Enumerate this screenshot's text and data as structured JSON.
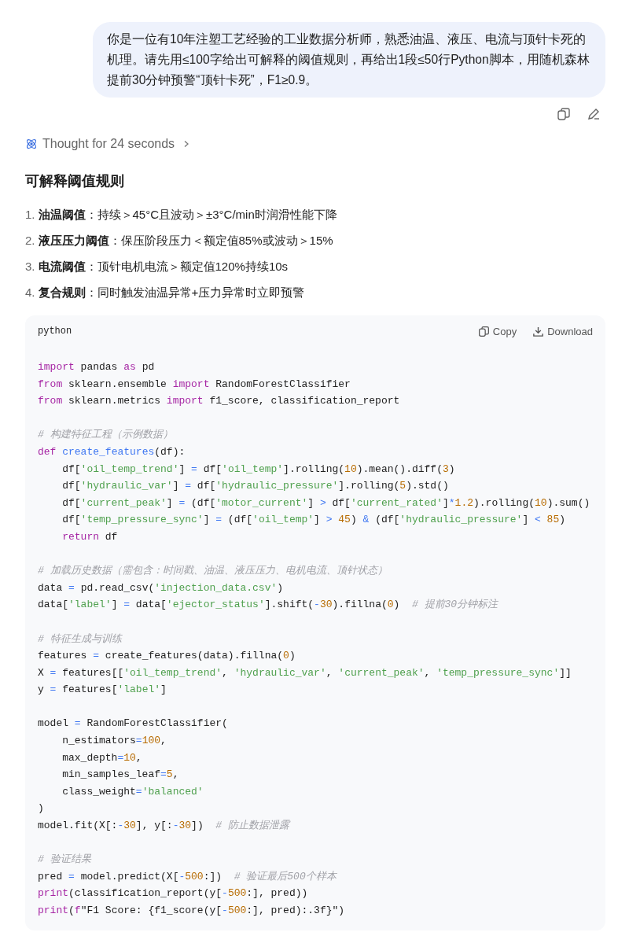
{
  "user_message": {
    "text": "你是一位有10年注塑工艺经验的工业数据分析师，熟悉油温、液压、电流与顶针卡死的机理。请先用≤100字给出可解释的阈值规则，再给出1段≤50行Python脚本，用随机森林提前30分钟预警“顶针卡死”，F1≥0.9。"
  },
  "thought": {
    "label": "Thought for 24 seconds",
    "expanded": false
  },
  "heading": "可解释阈值规则",
  "rules": [
    {
      "number": "1.",
      "text": "**油温阈值**：持续＞45°C且波动＞±3°C/min时润滑性能下降"
    },
    {
      "number": "2.",
      "text": "**液压压力阈值**：保压阶段压力＜额定值85%或波动＞15%"
    },
    {
      "number": "3.",
      "text": "**电流阈值**：顶针电机电流＞额定值120%持续10s"
    },
    {
      "number": "4.",
      "text": "**复合规则**：同时触发油温异常+压力异常时立即预警"
    }
  ],
  "code_block": {
    "language": "python",
    "copy_label": "Copy",
    "download_label": "Download",
    "lines": [
      {
        "kind": "code",
        "tokens": [
          {
            "kind": "kw",
            "text": "import"
          },
          {
            "kind": "plain",
            "text": " pandas "
          },
          {
            "kind": "kw",
            "text": "as"
          },
          {
            "kind": "plain",
            "text": " pd"
          }
        ]
      },
      {
        "kind": "code",
        "tokens": [
          {
            "kind": "kw",
            "text": "from"
          },
          {
            "kind": "plain",
            "text": " sklearn.ensemble "
          },
          {
            "kind": "kw",
            "text": "import"
          },
          {
            "kind": "plain",
            "text": " RandomForestClassifier"
          }
        ]
      },
      {
        "kind": "code",
        "tokens": [
          {
            "kind": "kw",
            "text": "from"
          },
          {
            "kind": "plain",
            "text": " sklearn.metrics "
          },
          {
            "kind": "kw",
            "text": "import"
          },
          {
            "kind": "plain",
            "text": " f1_score, classification_report"
          }
        ]
      },
      {
        "kind": "blank"
      },
      {
        "kind": "code",
        "tokens": [
          {
            "kind": "com",
            "text": "# 构建特征工程（示例数据）"
          }
        ]
      },
      {
        "kind": "code",
        "tokens": [
          {
            "kind": "kw",
            "text": "def "
          },
          {
            "kind": "fn",
            "text": "create_features"
          },
          {
            "kind": "plain",
            "text": "(df):"
          }
        ]
      },
      {
        "kind": "code",
        "tokens": [
          {
            "kind": "plain",
            "text": "    df["
          },
          {
            "kind": "str",
            "text": "'oil_temp_trend'"
          },
          {
            "kind": "plain",
            "text": "] "
          },
          {
            "kind": "op",
            "text": "="
          },
          {
            "kind": "plain",
            "text": " df["
          },
          {
            "kind": "str",
            "text": "'oil_temp'"
          },
          {
            "kind": "plain",
            "text": "].rolling("
          },
          {
            "kind": "num",
            "text": "10"
          },
          {
            "kind": "plain",
            "text": ").mean().diff("
          },
          {
            "kind": "num",
            "text": "3"
          },
          {
            "kind": "plain",
            "text": ")"
          }
        ]
      },
      {
        "kind": "code",
        "tokens": [
          {
            "kind": "plain",
            "text": "    df["
          },
          {
            "kind": "str",
            "text": "'hydraulic_var'"
          },
          {
            "kind": "plain",
            "text": "] "
          },
          {
            "kind": "op",
            "text": "="
          },
          {
            "kind": "plain",
            "text": " df["
          },
          {
            "kind": "str",
            "text": "'hydraulic_pressure'"
          },
          {
            "kind": "plain",
            "text": "].rolling("
          },
          {
            "kind": "num",
            "text": "5"
          },
          {
            "kind": "plain",
            "text": ").std()"
          }
        ]
      },
      {
        "kind": "code",
        "tokens": [
          {
            "kind": "plain",
            "text": "    df["
          },
          {
            "kind": "str",
            "text": "'current_peak'"
          },
          {
            "kind": "plain",
            "text": "] "
          },
          {
            "kind": "op",
            "text": "="
          },
          {
            "kind": "plain",
            "text": " (df["
          },
          {
            "kind": "str",
            "text": "'motor_current'"
          },
          {
            "kind": "plain",
            "text": "] "
          },
          {
            "kind": "op",
            "text": ">"
          },
          {
            "kind": "plain",
            "text": " df["
          },
          {
            "kind": "str",
            "text": "'current_rated'"
          },
          {
            "kind": "plain",
            "text": "]"
          },
          {
            "kind": "op",
            "text": "*"
          },
          {
            "kind": "num",
            "text": "1.2"
          },
          {
            "kind": "plain",
            "text": ").rolling("
          },
          {
            "kind": "num",
            "text": "10"
          },
          {
            "kind": "plain",
            "text": ").sum()"
          }
        ]
      },
      {
        "kind": "code",
        "tokens": [
          {
            "kind": "plain",
            "text": "    df["
          },
          {
            "kind": "str",
            "text": "'temp_pressure_sync'"
          },
          {
            "kind": "plain",
            "text": "] "
          },
          {
            "kind": "op",
            "text": "="
          },
          {
            "kind": "plain",
            "text": " (df["
          },
          {
            "kind": "str",
            "text": "'oil_temp'"
          },
          {
            "kind": "plain",
            "text": "] "
          },
          {
            "kind": "op",
            "text": "> "
          },
          {
            "kind": "num",
            "text": "45"
          },
          {
            "kind": "plain",
            "text": ") "
          },
          {
            "kind": "op",
            "text": "&"
          },
          {
            "kind": "plain",
            "text": " (df["
          },
          {
            "kind": "str",
            "text": "'hydraulic_pressure'"
          },
          {
            "kind": "plain",
            "text": "] "
          },
          {
            "kind": "op",
            "text": "< "
          },
          {
            "kind": "num",
            "text": "85"
          },
          {
            "kind": "plain",
            "text": ")"
          }
        ]
      },
      {
        "kind": "code",
        "tokens": [
          {
            "kind": "kw",
            "text": "    return"
          },
          {
            "kind": "plain",
            "text": " df"
          }
        ]
      },
      {
        "kind": "blank"
      },
      {
        "kind": "code",
        "tokens": [
          {
            "kind": "com",
            "text": "# 加载历史数据（需包含：时间戳、油温、液压压力、电机电流、顶针状态）"
          }
        ]
      },
      {
        "kind": "code",
        "tokens": [
          {
            "kind": "plain",
            "text": "data "
          },
          {
            "kind": "op",
            "text": "="
          },
          {
            "kind": "plain",
            "text": " pd.read_csv("
          },
          {
            "kind": "str",
            "text": "'injection_data.csv'"
          },
          {
            "kind": "plain",
            "text": ")"
          }
        ]
      },
      {
        "kind": "code",
        "tokens": [
          {
            "kind": "plain",
            "text": "data["
          },
          {
            "kind": "str",
            "text": "'label'"
          },
          {
            "kind": "plain",
            "text": "] "
          },
          {
            "kind": "op",
            "text": "="
          },
          {
            "kind": "plain",
            "text": " data["
          },
          {
            "kind": "str",
            "text": "'ejector_status'"
          },
          {
            "kind": "plain",
            "text": "].shift("
          },
          {
            "kind": "op",
            "text": "-"
          },
          {
            "kind": "num",
            "text": "30"
          },
          {
            "kind": "plain",
            "text": ").fillna("
          },
          {
            "kind": "num",
            "text": "0"
          },
          {
            "kind": "plain",
            "text": ")  "
          },
          {
            "kind": "com",
            "text": "# 提前30分钟标注"
          }
        ]
      },
      {
        "kind": "blank"
      },
      {
        "kind": "code",
        "tokens": [
          {
            "kind": "com",
            "text": "# 特征生成与训练"
          }
        ]
      },
      {
        "kind": "code",
        "tokens": [
          {
            "kind": "plain",
            "text": "features "
          },
          {
            "kind": "op",
            "text": "="
          },
          {
            "kind": "plain",
            "text": " create_features(data).fillna("
          },
          {
            "kind": "num",
            "text": "0"
          },
          {
            "kind": "plain",
            "text": ")"
          }
        ]
      },
      {
        "kind": "code",
        "tokens": [
          {
            "kind": "plain",
            "text": "X "
          },
          {
            "kind": "op",
            "text": "="
          },
          {
            "kind": "plain",
            "text": " features[["
          },
          {
            "kind": "str",
            "text": "'oil_temp_trend'"
          },
          {
            "kind": "plain",
            "text": ", "
          },
          {
            "kind": "str",
            "text": "'hydraulic_var'"
          },
          {
            "kind": "plain",
            "text": ", "
          },
          {
            "kind": "str",
            "text": "'current_peak'"
          },
          {
            "kind": "plain",
            "text": ", "
          },
          {
            "kind": "str",
            "text": "'temp_pressure_sync'"
          },
          {
            "kind": "plain",
            "text": "]]"
          }
        ]
      },
      {
        "kind": "code",
        "tokens": [
          {
            "kind": "plain",
            "text": "y "
          },
          {
            "kind": "op",
            "text": "="
          },
          {
            "kind": "plain",
            "text": " features["
          },
          {
            "kind": "str",
            "text": "'label'"
          },
          {
            "kind": "plain",
            "text": "]"
          }
        ]
      },
      {
        "kind": "blank"
      },
      {
        "kind": "code",
        "tokens": [
          {
            "kind": "plain",
            "text": "model "
          },
          {
            "kind": "op",
            "text": "="
          },
          {
            "kind": "plain",
            "text": " RandomForestClassifier("
          }
        ]
      },
      {
        "kind": "code",
        "tokens": [
          {
            "kind": "plain",
            "text": "    n_estimators"
          },
          {
            "kind": "op",
            "text": "="
          },
          {
            "kind": "num",
            "text": "100"
          },
          {
            "kind": "plain",
            "text": ","
          }
        ]
      },
      {
        "kind": "code",
        "tokens": [
          {
            "kind": "plain",
            "text": "    max_depth"
          },
          {
            "kind": "op",
            "text": "="
          },
          {
            "kind": "num",
            "text": "10"
          },
          {
            "kind": "plain",
            "text": ","
          }
        ]
      },
      {
        "kind": "code",
        "tokens": [
          {
            "kind": "plain",
            "text": "    min_samples_leaf"
          },
          {
            "kind": "op",
            "text": "="
          },
          {
            "kind": "num",
            "text": "5"
          },
          {
            "kind": "plain",
            "text": ","
          }
        ]
      },
      {
        "kind": "code",
        "tokens": [
          {
            "kind": "plain",
            "text": "    class_weight"
          },
          {
            "kind": "op",
            "text": "="
          },
          {
            "kind": "str",
            "text": "'balanced'"
          }
        ]
      },
      {
        "kind": "code",
        "tokens": [
          {
            "kind": "plain",
            "text": ")"
          }
        ]
      },
      {
        "kind": "code",
        "tokens": [
          {
            "kind": "plain",
            "text": "model.fit(X[:"
          },
          {
            "kind": "op",
            "text": "-"
          },
          {
            "kind": "num",
            "text": "30"
          },
          {
            "kind": "plain",
            "text": "], y[:"
          },
          {
            "kind": "op",
            "text": "-"
          },
          {
            "kind": "num",
            "text": "30"
          },
          {
            "kind": "plain",
            "text": "])  "
          },
          {
            "kind": "com",
            "text": "# 防止数据泄露"
          }
        ]
      },
      {
        "kind": "blank"
      },
      {
        "kind": "code",
        "tokens": [
          {
            "kind": "com",
            "text": "# 验证结果"
          }
        ]
      },
      {
        "kind": "code",
        "tokens": [
          {
            "kind": "plain",
            "text": "pred "
          },
          {
            "kind": "op",
            "text": "="
          },
          {
            "kind": "plain",
            "text": " model.predict(X["
          },
          {
            "kind": "op",
            "text": "-"
          },
          {
            "kind": "num",
            "text": "500"
          },
          {
            "kind": "plain",
            "text": ":])  "
          },
          {
            "kind": "com",
            "text": "# 验证最后500个样本"
          }
        ]
      },
      {
        "kind": "code",
        "tokens": [
          {
            "kind": "kw",
            "text": "print"
          },
          {
            "kind": "plain",
            "text": "(classification_report(y["
          },
          {
            "kind": "op",
            "text": "-"
          },
          {
            "kind": "num",
            "text": "500"
          },
          {
            "kind": "plain",
            "text": ":], pred))"
          }
        ]
      },
      {
        "kind": "code",
        "tokens": [
          {
            "kind": "kw",
            "text": "print"
          },
          {
            "kind": "plain",
            "text": "("
          },
          {
            "kind": "kw",
            "text": "f"
          },
          {
            "kind": "plain",
            "text": "\"F1 Score: {f1_score(y["
          },
          {
            "kind": "op",
            "text": "-"
          },
          {
            "kind": "num",
            "text": "500"
          },
          {
            "kind": "plain",
            "text": ":], pred):.3f}\")"
          }
        ]
      }
    ]
  }
}
